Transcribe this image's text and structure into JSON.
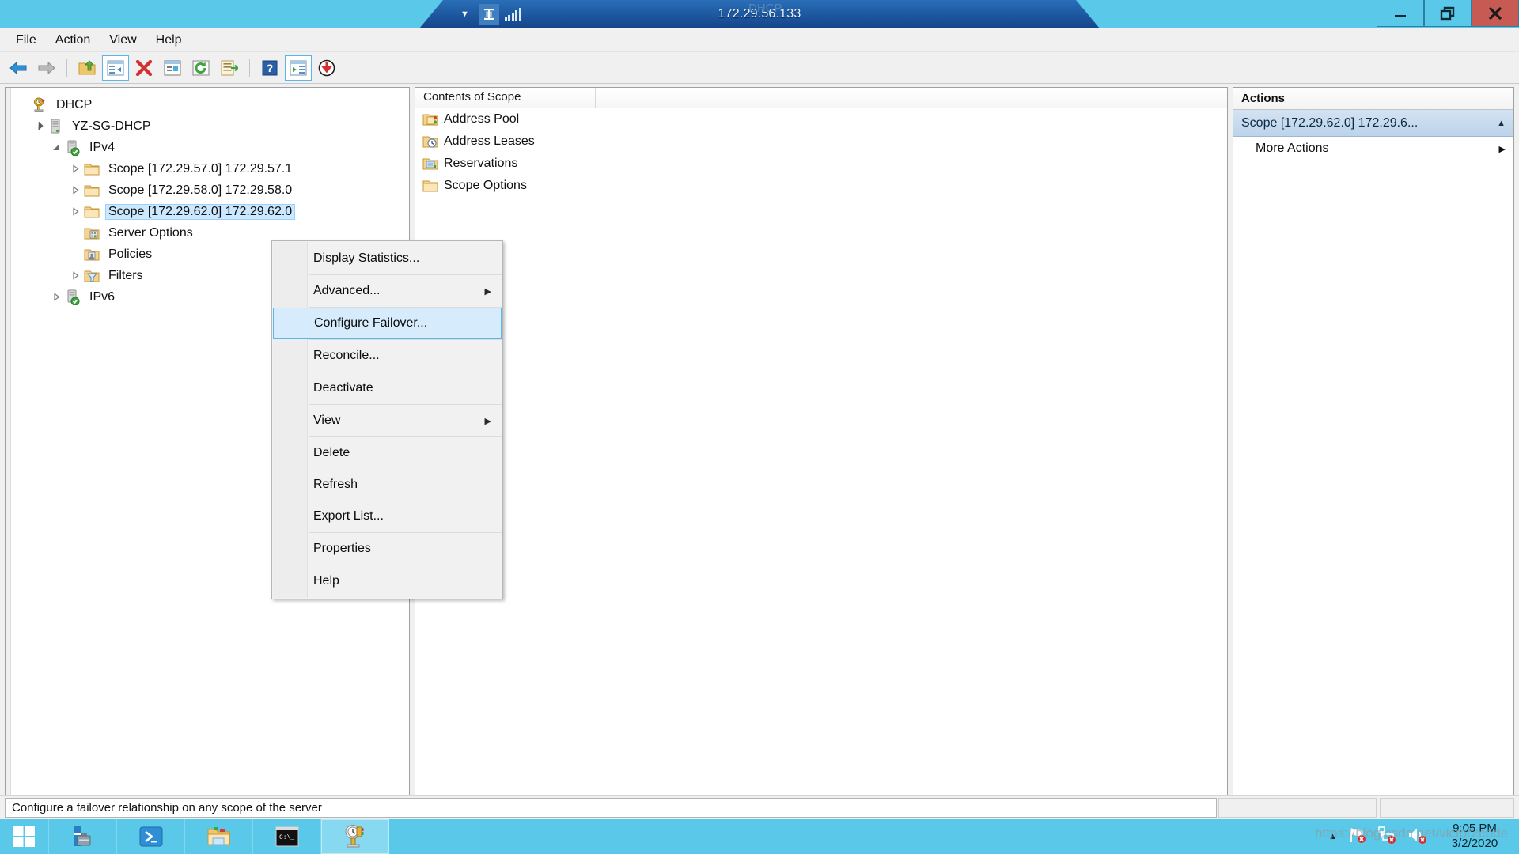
{
  "rdp_bar": {
    "title": "172.29.56.133",
    "pin_icon": "pin-icon",
    "signal_icon": "signal-strength-icon",
    "chevron_icon": "chevron-down-icon",
    "minimize_label": "Minimize",
    "restore_label": "Restore",
    "close_label": "Close"
  },
  "outer_window": {
    "minimize_label": "Minimize",
    "restore_label": "Restore Down",
    "close_label": "Close",
    "close_color": "#c75b53",
    "chrome_color": "#5ac8e8"
  },
  "menubar": {
    "items": [
      {
        "label": "File",
        "name": "menu-file"
      },
      {
        "label": "Action",
        "name": "menu-action"
      },
      {
        "label": "View",
        "name": "menu-view"
      },
      {
        "label": "Help",
        "name": "menu-help"
      }
    ]
  },
  "toolbar": {
    "buttons": [
      {
        "name": "back-button",
        "icon": "back-arrow-icon"
      },
      {
        "name": "forward-button",
        "icon": "forward-arrow-icon"
      },
      {
        "name": "up-one-level-button",
        "icon": "folder-up-icon"
      },
      {
        "name": "show-hide-console-tree-button",
        "icon": "console-tree-icon"
      },
      {
        "name": "delete-button",
        "icon": "red-x-icon"
      },
      {
        "name": "properties-button",
        "icon": "properties-icon"
      },
      {
        "name": "refresh-button",
        "icon": "refresh-icon"
      },
      {
        "name": "export-list-button",
        "icon": "export-list-icon"
      },
      {
        "name": "help-button",
        "icon": "help-icon"
      },
      {
        "name": "show-hide-action-pane-button",
        "icon": "action-pane-icon"
      },
      {
        "name": "deactivate-button",
        "icon": "down-arrow-circle-icon"
      }
    ]
  },
  "tree": {
    "nodes": [
      {
        "label": "DHCP",
        "icon": "dhcp-root-icon",
        "indent": 0,
        "expander": "none",
        "selected": false
      },
      {
        "label": "YZ-SG-DHCP",
        "icon": "server-icon",
        "indent": 1,
        "expander": "expanded",
        "selected": false
      },
      {
        "label": "IPv4",
        "icon": "ipv4-icon",
        "indent": 2,
        "expander": "expanded",
        "selected": false
      },
      {
        "label": "Scope [172.29.57.0] 172.29.57.1",
        "icon": "scope-folder-icon",
        "indent": 3,
        "expander": "collapsed",
        "selected": false
      },
      {
        "label": "Scope [172.29.58.0] 172.29.58.0",
        "icon": "scope-folder-icon",
        "indent": 3,
        "expander": "collapsed",
        "selected": false
      },
      {
        "label": "Scope [172.29.62.0] 172.29.62.0",
        "icon": "scope-folder-icon",
        "indent": 3,
        "expander": "collapsed",
        "selected": true
      },
      {
        "label": "Server Options",
        "icon": "server-options-icon",
        "indent": 3,
        "expander": "none",
        "selected": false
      },
      {
        "label": "Policies",
        "icon": "policies-icon",
        "indent": 3,
        "expander": "none",
        "selected": false
      },
      {
        "label": "Filters",
        "icon": "filters-funnel-icon",
        "indent": 3,
        "expander": "collapsed",
        "selected": false
      },
      {
        "label": "IPv6",
        "icon": "ipv6-icon",
        "indent": 2,
        "expander": "collapsed",
        "selected": false
      }
    ]
  },
  "contents": {
    "column_header": "Contents of Scope",
    "column_header_2": "",
    "rows": [
      {
        "label": "Address Pool",
        "icon": "address-pool-icon"
      },
      {
        "label": "Address Leases",
        "icon": "address-leases-icon"
      },
      {
        "label": "Reservations",
        "icon": "reservations-icon"
      },
      {
        "label": "Scope Options",
        "icon": "scope-options-icon"
      }
    ]
  },
  "actions": {
    "title": "Actions",
    "header": "Scope [172.29.62.0] 172.29.6...",
    "header_caret": "collapse-caret-icon",
    "items": [
      {
        "label": "More Actions",
        "arrow": "submenu-arrow-icon"
      }
    ]
  },
  "context_menu": {
    "items": [
      {
        "label": "Display Statistics...",
        "submenu": false,
        "selected": false,
        "sep_after": true
      },
      {
        "label": "Advanced...",
        "submenu": true,
        "selected": false,
        "sep_after": true
      },
      {
        "label": "Configure Failover...",
        "submenu": false,
        "selected": true,
        "sep_after": true
      },
      {
        "label": "Reconcile...",
        "submenu": false,
        "selected": false,
        "sep_after": true
      },
      {
        "label": "Deactivate",
        "submenu": false,
        "selected": false,
        "sep_after": true
      },
      {
        "label": "View",
        "submenu": true,
        "selected": false,
        "sep_after": true
      },
      {
        "label": "Delete",
        "submenu": false,
        "selected": false,
        "sep_after": false
      },
      {
        "label": "Refresh",
        "submenu": false,
        "selected": false,
        "sep_after": false
      },
      {
        "label": "Export List...",
        "submenu": false,
        "selected": false,
        "sep_after": true
      },
      {
        "label": "Properties",
        "submenu": false,
        "selected": false,
        "sep_after": true
      },
      {
        "label": "Help",
        "submenu": false,
        "selected": false,
        "sep_after": false
      }
    ],
    "highlight_color": "#d6ebfb",
    "highlight_border": "#5fb4e8"
  },
  "statusbar": {
    "message": "Configure a failover relationship on any scope of the server"
  },
  "taskbar": {
    "start_icon": "windows-start-icon",
    "buttons": [
      {
        "name": "taskbar-server-manager",
        "icon": "server-manager-icon",
        "active": false
      },
      {
        "name": "taskbar-powershell",
        "icon": "powershell-icon",
        "active": false
      },
      {
        "name": "taskbar-file-explorer",
        "icon": "file-explorer-icon",
        "active": false
      },
      {
        "name": "taskbar-command-prompt",
        "icon": "command-prompt-icon",
        "active": false
      },
      {
        "name": "taskbar-dhcp-console",
        "icon": "dhcp-console-icon",
        "active": true
      }
    ],
    "tray": {
      "expand_icon": "show-hidden-icons-caret",
      "icons": [
        {
          "name": "action-center-flag-icon",
          "badge": "error"
        },
        {
          "name": "network-icon",
          "badge": "error"
        },
        {
          "name": "volume-icon",
          "badge": "error"
        }
      ]
    },
    "clock": {
      "time": "9:05 PM",
      "date": "3/2/2020"
    }
  },
  "watermark": {
    "text": "https://blog.csdn.net/victor2code"
  }
}
